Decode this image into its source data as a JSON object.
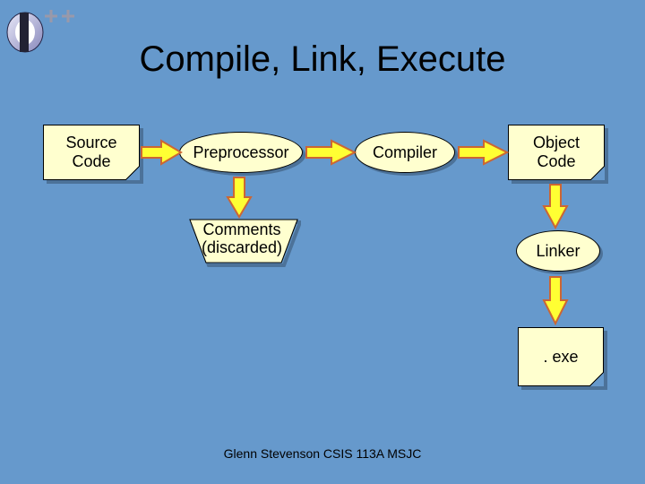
{
  "title": "Compile, Link, Execute",
  "footer": "Glenn Stevenson CSIS 113A MSJC",
  "boxes": {
    "source": "Source\nCode",
    "preproc": "Preprocessor",
    "compiler": "Compiler",
    "object": "Object\nCode",
    "comments_l1": "Comments",
    "comments_l2": "(discarded)",
    "linker": "Linker",
    "exe": ". exe"
  },
  "colors": {
    "bg": "#6699cc",
    "box": "#ffffcf",
    "arrow_fill": "#ffff33",
    "arrow_stroke": "#cc6633"
  }
}
